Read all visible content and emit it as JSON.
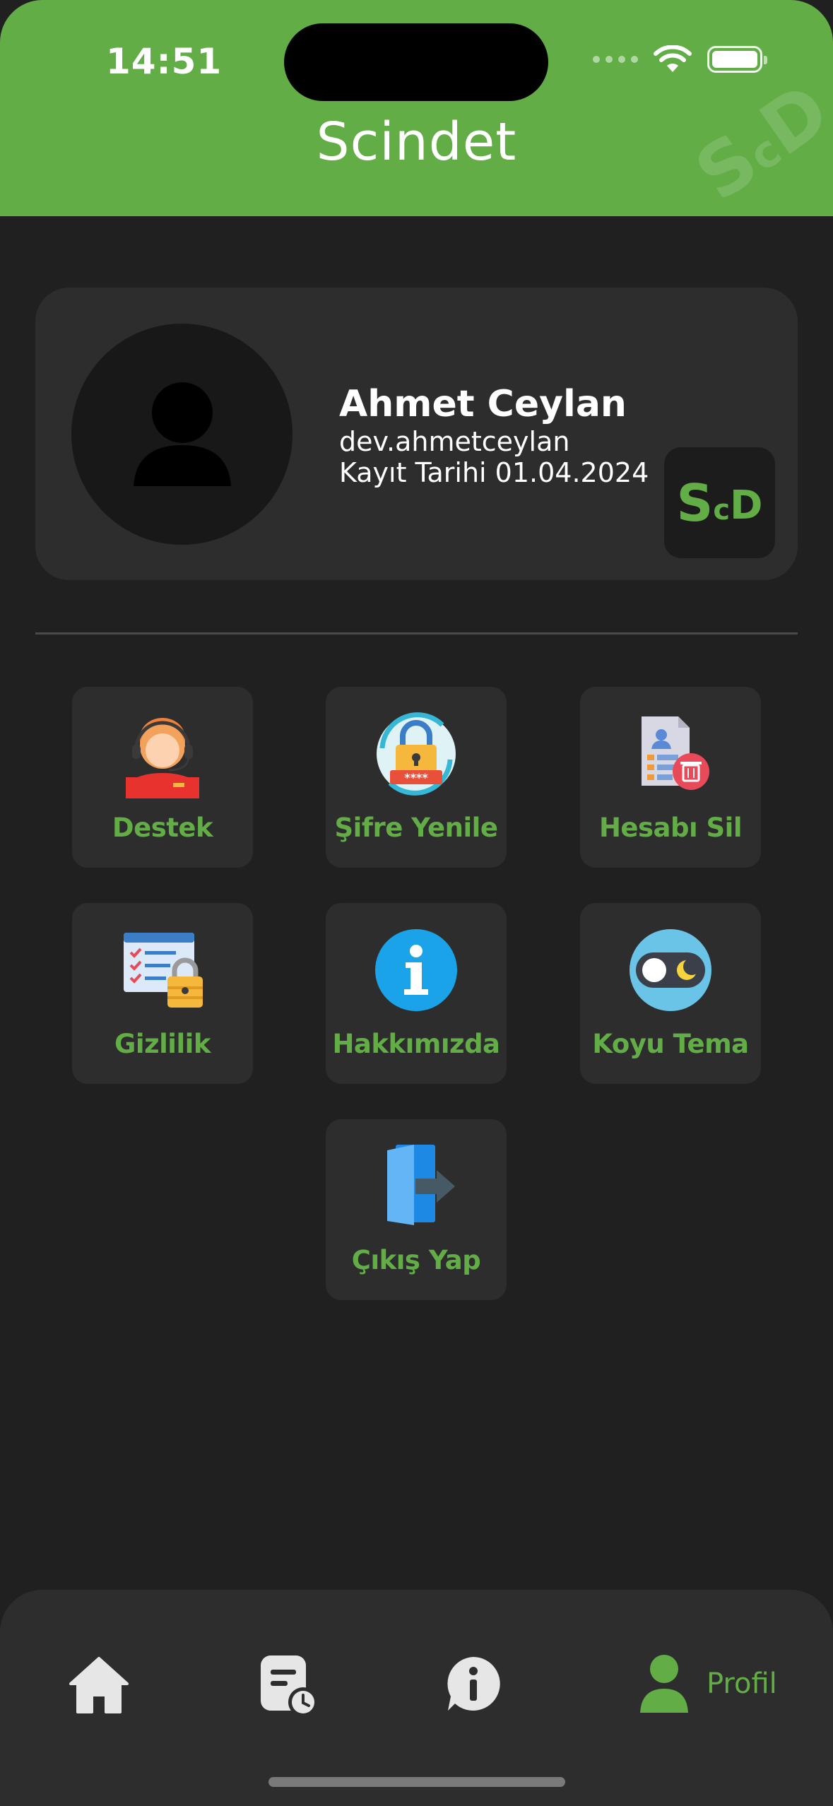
{
  "status_bar": {
    "time": "14:51"
  },
  "header": {
    "title": "Scindet",
    "logo": {
      "s": "S",
      "c": "c",
      "d": "D"
    }
  },
  "profile": {
    "name": "Ahmet Ceylan",
    "handle": "dev.ahmetceylan",
    "registered": "Kayıt Tarihi 01.04.2024",
    "badge": {
      "s": "S",
      "c": "c",
      "d": "D"
    }
  },
  "menu": {
    "support": "Destek",
    "password_reset": "Şifre Yenile",
    "delete_account": "Hesabı Sil",
    "privacy": "Gizlilik",
    "about": "Hakkımızda",
    "dark_theme": "Koyu Tema",
    "logout": "Çıkış Yap"
  },
  "bottom_nav": {
    "items": [
      {
        "icon": "home-icon"
      },
      {
        "icon": "history-icon"
      },
      {
        "icon": "info-icon"
      },
      {
        "icon": "profile-icon",
        "label": "Profil",
        "active": true
      }
    ]
  },
  "colors": {
    "accent": "#62ad46",
    "background": "#202020",
    "card": "#2d2d2d"
  }
}
